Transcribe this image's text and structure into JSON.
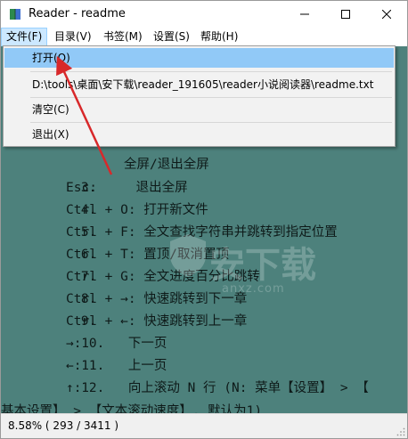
{
  "window": {
    "title": "Reader - readme",
    "icon": "book-icon",
    "controls": {
      "minimize": "minimize-icon",
      "maximize": "maximize-icon",
      "close": "close-icon"
    }
  },
  "menubar": {
    "items": [
      {
        "label": "文件(F)"
      },
      {
        "label": "目录(V)"
      },
      {
        "label": "书签(M)"
      },
      {
        "label": "设置(S)"
      },
      {
        "label": "帮助(H)"
      }
    ]
  },
  "file_menu": {
    "open": "打开(O)",
    "recent": "D:\\tools\\桌面\\安下载\\reader_191605\\reader小说阅读器\\readme.txt",
    "clear": "清空(C)",
    "exit": "退出(X)"
  },
  "content": {
    "background": "#4d817c",
    "lines": [
      {
        "num": "",
        "text": "全屏/退出全屏"
      },
      {
        "num": "3.",
        "text": "Esc:     退出全屏"
      },
      {
        "num": "4.",
        "text": "Ctrl + O: 打开新文件"
      },
      {
        "num": "5.",
        "text": "Ctrl + F: 全文查找字符串并跳转到指定位置"
      },
      {
        "num": "6.",
        "text": "Ctrl + T: 置顶/取消置顶"
      },
      {
        "num": "7.",
        "text": "Ctrl + G: 全文进度百分比跳转"
      },
      {
        "num": "8.",
        "text": "Ctrl + →: 快速跳转到下一章"
      },
      {
        "num": "9.",
        "text": "Ctrl + ←: 快速跳转到上一章"
      },
      {
        "num": "10.",
        "text": "→:      下一页"
      },
      {
        "num": "11.",
        "text": "←:      上一页"
      },
      {
        "num": "12.",
        "text": "↑:      向上滚动 N 行 (N: 菜单【设置】 > 【"
      },
      {
        "num": "",
        "text": "基本设置】 > 【文本滚动速度】, 默认为1)"
      }
    ]
  },
  "status": {
    "text": "8.58% ( 293 / 3411 )",
    "grip_icon": "resize-grip-icon"
  },
  "watermark": {
    "main": "安下载",
    "sub": "anxz.com"
  },
  "annotation": {
    "color": "#d8282a"
  }
}
